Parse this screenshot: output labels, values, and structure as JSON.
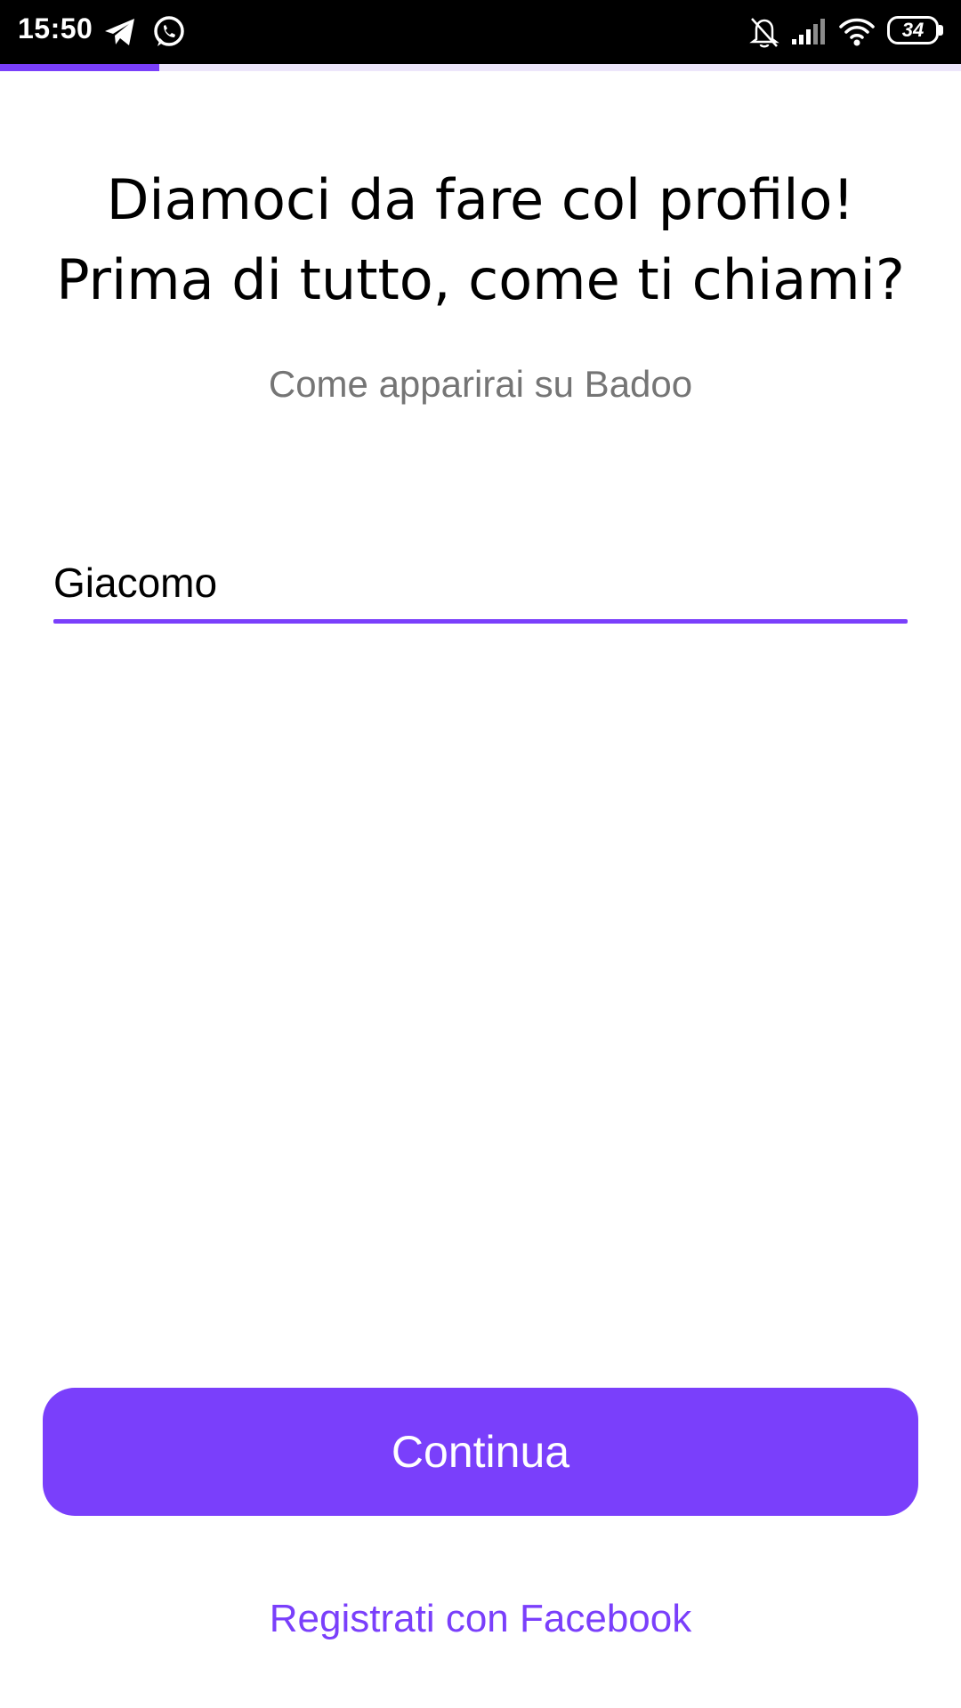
{
  "status_bar": {
    "time": "15:50",
    "icons": [
      "telegram-icon",
      "whatsapp-icon",
      "notifications-off-icon",
      "signal-icon",
      "wifi-icon",
      "battery-icon"
    ],
    "battery_level": "34"
  },
  "progress": {
    "fraction": 0.166
  },
  "onboarding": {
    "headline_line1": "Diamoci da fare col profilo!",
    "headline_line2": "Prima di tutto, come ti chiami?",
    "subtitle": "Come apparirai su Badoo",
    "name_value": "Giacomo",
    "continue_label": "Continua",
    "facebook_label": "Registrati con Facebook"
  },
  "colors": {
    "accent": "#7a3ffb",
    "progress_track": "#ede6fb",
    "subtitle": "#757575",
    "status_bar_bg": "#000000"
  }
}
